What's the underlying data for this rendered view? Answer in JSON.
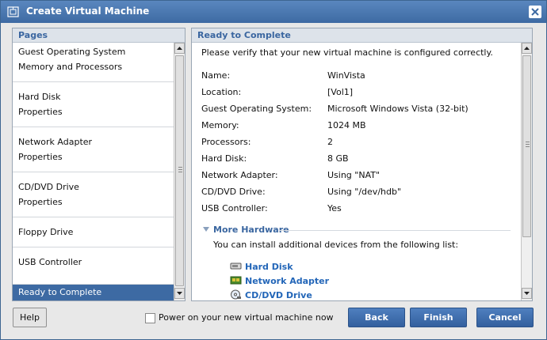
{
  "window": {
    "title": "Create Virtual Machine"
  },
  "pages": {
    "header": "Pages",
    "groups": [
      {
        "items": [
          "Guest Operating System",
          "Memory and Processors"
        ]
      },
      {
        "items": [
          "Hard Disk",
          "Properties"
        ]
      },
      {
        "items": [
          "Network Adapter",
          "Properties"
        ]
      },
      {
        "items": [
          "CD/DVD Drive",
          "Properties"
        ]
      },
      {
        "items": [
          "Floppy Drive"
        ]
      },
      {
        "items": [
          "USB Controller"
        ]
      },
      {
        "items": [
          "Ready to Complete"
        ],
        "selected": true
      }
    ]
  },
  "summary": {
    "header": "Ready to Complete",
    "verify_text": "Please verify that your new virtual machine is configured correctly.",
    "rows": [
      {
        "label": "Name:",
        "value": "WinVista"
      },
      {
        "label": "Location:",
        "value": "[Vol1]"
      },
      {
        "label": "Guest Operating System:",
        "value": "Microsoft Windows Vista (32-bit)"
      },
      {
        "label": "Memory:",
        "value": "1024 MB"
      },
      {
        "label": "Processors:",
        "value": "2"
      },
      {
        "label": "Hard Disk:",
        "value": "8 GB"
      },
      {
        "label": "Network Adapter:",
        "value": "Using \"NAT\""
      },
      {
        "label": "CD/DVD Drive:",
        "value": "Using \"/dev/hdb\""
      },
      {
        "label": "USB Controller:",
        "value": "Yes"
      }
    ],
    "more_hardware_title": "More Hardware",
    "install_text": "You can install additional devices from the following list:",
    "hardware_links": [
      "Hard Disk",
      "Network Adapter",
      "CD/DVD Drive"
    ]
  },
  "footer": {
    "help_label": "Help",
    "power_on_label": "Power on your new virtual machine now",
    "back_label": "Back",
    "finish_label": "Finish",
    "cancel_label": "Cancel"
  },
  "colors": {
    "accent": "#3d6aa3",
    "link": "#2366b8"
  }
}
